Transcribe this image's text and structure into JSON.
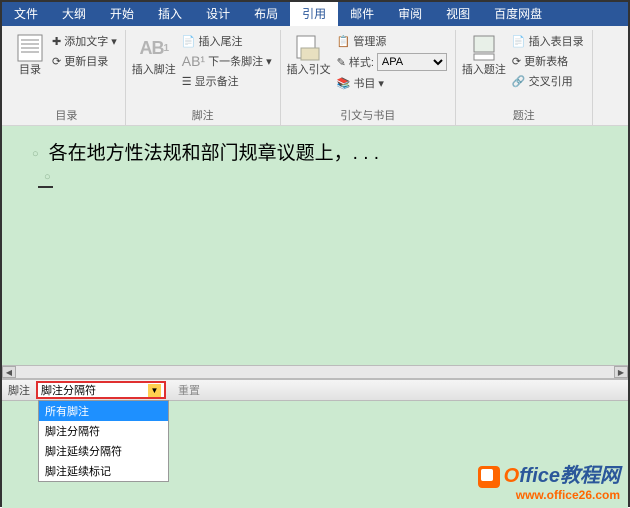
{
  "menubar": [
    "文件",
    "大纲",
    "开始",
    "插入",
    "设计",
    "布局",
    "引用",
    "邮件",
    "审阅",
    "视图",
    "百度网盘"
  ],
  "menubar_active_index": 6,
  "ribbon": {
    "groups": [
      {
        "label": "目录",
        "big": {
          "label": "目录"
        },
        "items": [
          "添加文字",
          "更新目录"
        ]
      },
      {
        "label": "脚注",
        "big": {
          "label": "插入脚注"
        },
        "items": [
          "插入尾注",
          "下一条脚注",
          "显示备注"
        ]
      },
      {
        "label": "引文与书目",
        "big": {
          "label": "插入引文"
        },
        "items_mgmt": "管理源",
        "items_style_label": "样式:",
        "items_style_value": "APA",
        "items_bib": "书目"
      },
      {
        "label": "题注",
        "big": {
          "label": "插入题注"
        },
        "items": [
          "插入表目录",
          "更新表格",
          "交叉引用"
        ]
      }
    ]
  },
  "document": {
    "line1": "各在地方性法规和部门规章议题上，. . ."
  },
  "footnote_pane": {
    "label": "脚注",
    "selected": "脚注分隔符",
    "reset": "重置",
    "options": [
      "所有脚注",
      "脚注分隔符",
      "脚注延续分隔符",
      "脚注延续标记"
    ],
    "highlighted_index": 0
  },
  "watermark": {
    "brand_prefix": "O",
    "brand_rest": "ffice教程网",
    "url": "www.office26.com"
  }
}
